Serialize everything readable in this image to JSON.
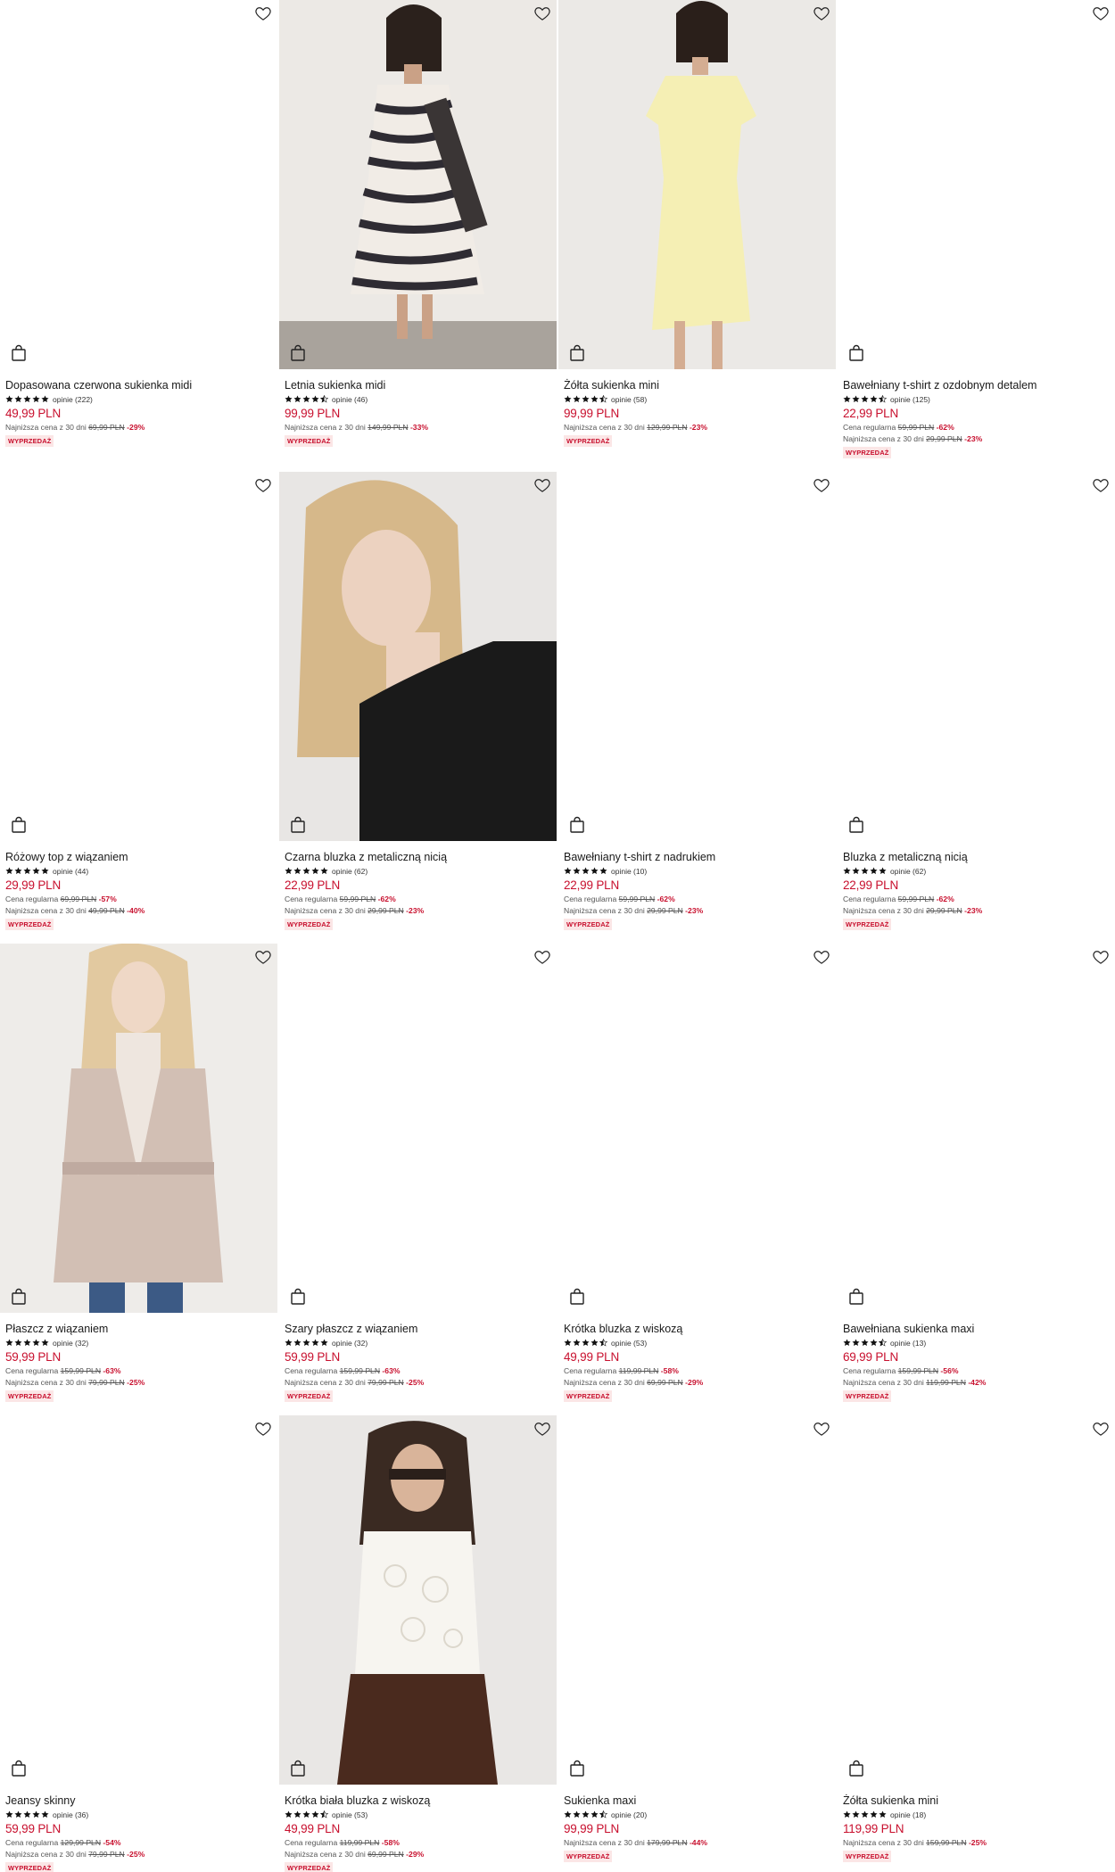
{
  "theme": {
    "sale_red": "#c8102e",
    "badge_bg": "#fbe6e6",
    "star": "#111111"
  },
  "icons": {
    "wishlist": "heart-outline-icon",
    "cart": "shopping-bag-icon",
    "rating": "star-icon"
  },
  "products": [
    {
      "title": "Dopasowana czerwona sukienka midi",
      "stars": 5,
      "reviews": "opinie (222)",
      "price": "49,99 PLN",
      "regular": null,
      "lowest": {
        "label": "Najniższa cena z 30 dni",
        "old": "69,99 PLN",
        "pct": "-29%"
      },
      "badge": "WYPRZEDAŻ",
      "photo": null
    },
    {
      "title": "Letnia sukienka midi",
      "stars": 4.5,
      "reviews": "opinie (46)",
      "price": "99,99 PLN",
      "regular": null,
      "lowest": {
        "label": "Najniższa cena z 30 dni",
        "old": "149,99 PLN",
        "pct": "-33%"
      },
      "badge": "WYPRZEDAŻ",
      "photo": "zebra-dress"
    },
    {
      "title": "Żółta sukienka mini",
      "stars": 4.5,
      "reviews": "opinie (58)",
      "price": "99,99 PLN",
      "regular": null,
      "lowest": {
        "label": "Najniższa cena z 30 dni",
        "old": "129,99 PLN",
        "pct": "-23%"
      },
      "badge": "WYPRZEDAŻ",
      "photo": "yellow-dress"
    },
    {
      "title": "Bawełniany t-shirt z ozdobnym detalem",
      "stars": 4.5,
      "reviews": "opinie (125)",
      "price": "22,99 PLN",
      "regular": {
        "label": "Cena regularna",
        "old": "59,99 PLN",
        "pct": "-62%"
      },
      "lowest": {
        "label": "Najniższa cena z 30 dni",
        "old": "29,99 PLN",
        "pct": "-23%"
      },
      "badge": "WYPRZEDAŻ",
      "photo": null
    },
    {
      "title": "Różowy top z wiązaniem",
      "stars": 5,
      "reviews": "opinie (44)",
      "price": "29,99 PLN",
      "regular": {
        "label": "Cena regularna",
        "old": "69,99 PLN",
        "pct": "-57%"
      },
      "lowest": {
        "label": "Najniższa cena z 30 dni",
        "old": "49,99 PLN",
        "pct": "-40%"
      },
      "badge": "WYPRZEDAŻ",
      "photo": null
    },
    {
      "title": "Czarna bluzka z metaliczną nicią",
      "stars": 5,
      "reviews": "opinie (62)",
      "price": "22,99 PLN",
      "regular": {
        "label": "Cena regularna",
        "old": "59,99 PLN",
        "pct": "-62%"
      },
      "lowest": {
        "label": "Najniższa cena z 30 dni",
        "old": "29,99 PLN",
        "pct": "-23%"
      },
      "badge": "WYPRZEDAŻ",
      "photo": "black-blouse"
    },
    {
      "title": "Bawełniany t-shirt z nadrukiem",
      "stars": 5,
      "reviews": "opinie (10)",
      "price": "22,99 PLN",
      "regular": {
        "label": "Cena regularna",
        "old": "59,99 PLN",
        "pct": "-62%"
      },
      "lowest": {
        "label": "Najniższa cena z 30 dni",
        "old": "29,99 PLN",
        "pct": "-23%"
      },
      "badge": "WYPRZEDAŻ",
      "photo": null
    },
    {
      "title": "Bluzka z metaliczną nicią",
      "stars": 5,
      "reviews": "opinie (62)",
      "price": "22,99 PLN",
      "regular": {
        "label": "Cena regularna",
        "old": "59,99 PLN",
        "pct": "-62%"
      },
      "lowest": {
        "label": "Najniższa cena z 30 dni",
        "old": "29,99 PLN",
        "pct": "-23%"
      },
      "badge": "WYPRZEDAŻ",
      "photo": null
    },
    {
      "title": "Płaszcz z wiązaniem",
      "stars": 5,
      "reviews": "opinie (32)",
      "price": "59,99 PLN",
      "regular": {
        "label": "Cena regularna",
        "old": "159,99 PLN",
        "pct": "-63%"
      },
      "lowest": {
        "label": "Najniższa cena z 30 dni",
        "old": "79,99 PLN",
        "pct": "-25%"
      },
      "badge": "WYPRZEDAŻ",
      "photo": "beige-coat"
    },
    {
      "title": "Szary płaszcz z wiązaniem",
      "stars": 5,
      "reviews": "opinie (32)",
      "price": "59,99 PLN",
      "regular": {
        "label": "Cena regularna",
        "old": "159,99 PLN",
        "pct": "-63%"
      },
      "lowest": {
        "label": "Najniższa cena z 30 dni",
        "old": "79,99 PLN",
        "pct": "-25%"
      },
      "badge": "WYPRZEDAŻ",
      "photo": null
    },
    {
      "title": "Krótka bluzka z wiskozą",
      "stars": 4.5,
      "reviews": "opinie (53)",
      "price": "49,99 PLN",
      "regular": {
        "label": "Cena regularna",
        "old": "119,99 PLN",
        "pct": "-58%"
      },
      "lowest": {
        "label": "Najniższa cena z 30 dni",
        "old": "69,99 PLN",
        "pct": "-29%"
      },
      "badge": "WYPRZEDAŻ",
      "photo": null
    },
    {
      "title": "Bawełniana sukienka maxi",
      "stars": 4.5,
      "reviews": "opinie (13)",
      "price": "69,99 PLN",
      "regular": {
        "label": "Cena regularna",
        "old": "159,99 PLN",
        "pct": "-56%"
      },
      "lowest": {
        "label": "Najniższa cena z 30 dni",
        "old": "119,99 PLN",
        "pct": "-42%"
      },
      "badge": "WYPRZEDAŻ",
      "photo": null
    },
    {
      "title": "Jeansy skinny",
      "stars": 5,
      "reviews": "opinie (36)",
      "price": "59,99 PLN",
      "regular": {
        "label": "Cena regularna",
        "old": "129,99 PLN",
        "pct": "-54%"
      },
      "lowest": {
        "label": "Najniższa cena z 30 dni",
        "old": "79,99 PLN",
        "pct": "-25%"
      },
      "badge": "WYPRZEDAŻ",
      "photo": null
    },
    {
      "title": "Krótka biała bluzka z wiskozą",
      "stars": 4.5,
      "reviews": "opinie (53)",
      "price": "49,99 PLN",
      "regular": {
        "label": "Cena regularna",
        "old": "119,99 PLN",
        "pct": "-58%"
      },
      "lowest": {
        "label": "Najniższa cena z 30 dni",
        "old": "69,99 PLN",
        "pct": "-29%"
      },
      "badge": "WYPRZEDAŻ",
      "photo": "white-lace-top"
    },
    {
      "title": "Sukienka maxi",
      "stars": 4.5,
      "reviews": "opinie (20)",
      "price": "99,99 PLN",
      "regular": null,
      "lowest": {
        "label": "Najniższa cena z 30 dni",
        "old": "179,99 PLN",
        "pct": "-44%"
      },
      "badge": "WYPRZEDAŻ",
      "photo": null
    },
    {
      "title": "Żółta sukienka mini",
      "stars": 5,
      "reviews": "opinie (18)",
      "price": "119,99 PLN",
      "regular": null,
      "lowest": {
        "label": "Najniższa cena z 30 dni",
        "old": "159,99 PLN",
        "pct": "-25%"
      },
      "badge": "WYPRZEDAŻ",
      "photo": null
    }
  ]
}
